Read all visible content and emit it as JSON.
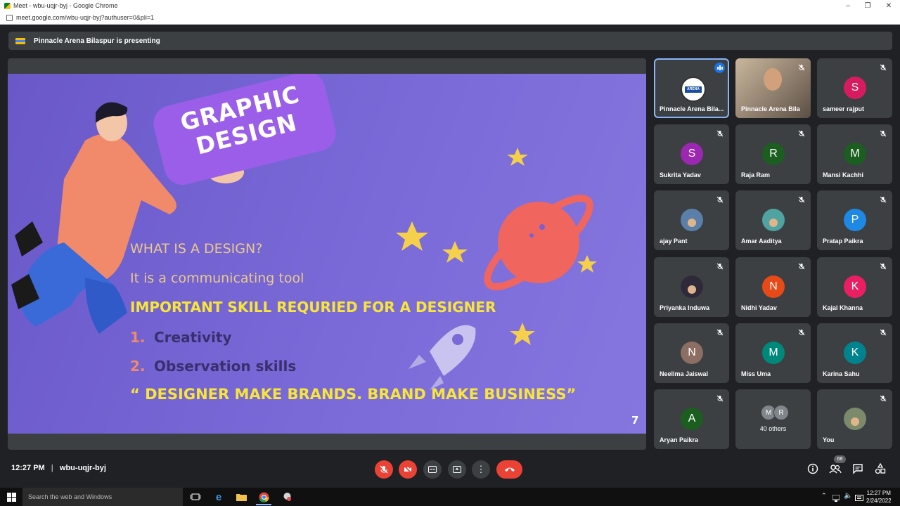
{
  "browser": {
    "window_title": "Meet - wbu-uqjr-byj - Google Chrome",
    "url": "meet.google.com/wbu-uqjr-byj?authuser=0&pli=1"
  },
  "banner": {
    "text": "Pinnacle Arena Bilaspur is presenting"
  },
  "slide": {
    "card_line1": "GRAPHIC",
    "card_line2": "DESIGN",
    "question": "WHAT IS A DESIGN?",
    "answer": "It is a communicating tool",
    "heading": "IMPORTANT SKILL REQURIED FOR A DESIGNER",
    "item1_num": "1.",
    "item1": "Creativity",
    "item2_num": "2.",
    "item2": "Observation skills",
    "quote": "“ DESIGNER MAKE BRANDS. BRAND MAKE BUSINESS”",
    "page_number": "7"
  },
  "participants": [
    {
      "name": "Pinnacle Arena Bila...",
      "initial": "",
      "color": "#ffffff",
      "kind": "logo",
      "state": "speaking"
    },
    {
      "name": "Pinnacle Arena Bila",
      "initial": "",
      "color": "#8a7a6a",
      "kind": "video",
      "state": "muted"
    },
    {
      "name": "sameer rajput",
      "initial": "S",
      "color": "#d81b60",
      "kind": "initial",
      "state": "muted"
    },
    {
      "name": "Sukrita Yadav",
      "initial": "S",
      "color": "#9c27b0",
      "kind": "initial",
      "state": "muted"
    },
    {
      "name": "Raja Ram",
      "initial": "R",
      "color": "#1b5e20",
      "kind": "initial",
      "state": "muted"
    },
    {
      "name": "Mansi Kachhi",
      "initial": "M",
      "color": "#1b5e20",
      "kind": "initial",
      "state": "muted"
    },
    {
      "name": "ajay Pant",
      "initial": "",
      "color": "#5a7fa8",
      "kind": "photo",
      "state": "muted"
    },
    {
      "name": "Amar Aaditya",
      "initial": "",
      "color": "#4fa3a0",
      "kind": "photo",
      "state": "muted"
    },
    {
      "name": "Pratap Paikra",
      "initial": "P",
      "color": "#1e88e5",
      "kind": "initial",
      "state": "muted"
    },
    {
      "name": "Priyanka Induwa",
      "initial": "",
      "color": "#2f2a3a",
      "kind": "photo",
      "state": "muted"
    },
    {
      "name": "Nidhi Yadav",
      "initial": "N",
      "color": "#e64a19",
      "kind": "initial",
      "state": "muted"
    },
    {
      "name": "Kajal Khanna",
      "initial": "K",
      "color": "#e91e63",
      "kind": "initial",
      "state": "muted"
    },
    {
      "name": "Neelima Jaiswal",
      "initial": "N",
      "color": "#8d6e63",
      "kind": "initial",
      "state": "muted"
    },
    {
      "name": "Miss Uma",
      "initial": "M",
      "color": "#00897b",
      "kind": "initial",
      "state": "muted"
    },
    {
      "name": "Karina Sahu",
      "initial": "K",
      "color": "#00838f",
      "kind": "initial",
      "state": "muted"
    },
    {
      "name": "Aryan Paikra",
      "initial": "A",
      "color": "#1b5e20",
      "kind": "initial",
      "state": "muted"
    },
    {
      "name": "",
      "initial": "",
      "color": "#3c4043",
      "kind": "others",
      "state": "none"
    },
    {
      "name": "You",
      "initial": "",
      "color": "#7a8a6a",
      "kind": "photo",
      "state": "muted"
    }
  ],
  "others": {
    "initials": [
      "M",
      "R"
    ],
    "label": "40 others"
  },
  "bottom": {
    "time": "12:27 PM",
    "separator": "|",
    "meeting_code": "wbu-uqjr-byj",
    "people_count": "68"
  },
  "taskbar": {
    "search_placeholder": "Search the web and Windows",
    "clock_time": "12:27 PM",
    "clock_date": "2/24/2022"
  },
  "colors": {
    "accent_blue": "#8ab4f8",
    "danger_red": "#ea4335",
    "tile_bg": "#3c4043"
  }
}
